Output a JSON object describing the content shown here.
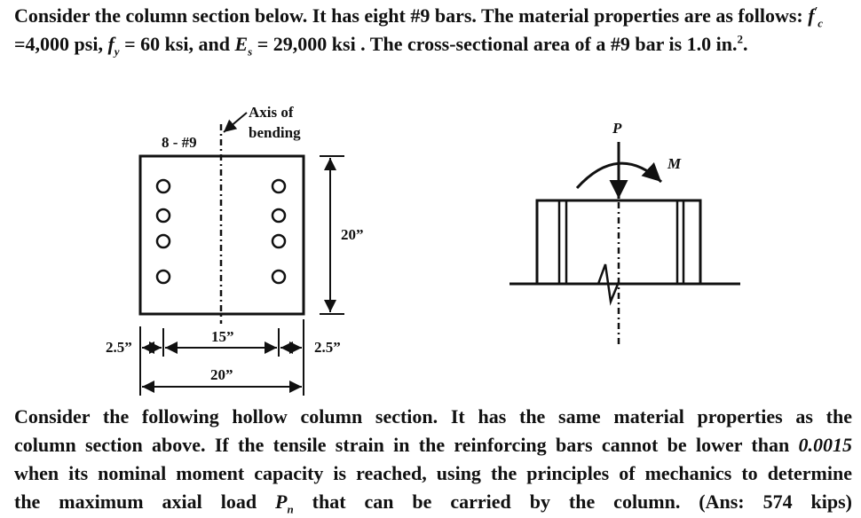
{
  "problem_intro": {
    "line1_text": "Consider the column section below. It has eight #9 bars. The material properties are as follows: ",
    "fc_symbol": "f",
    "fc_sub": "c",
    "fc_prime": "′",
    "line2_fc_value": "=4,000 psi, ",
    "fy_symbol": "f",
    "fy_sub": "y",
    "fy_value": " = 60 ksi, and ",
    "es_symbol": "E",
    "es_sub": "s",
    "es_value": " = 29,000 ksi . The cross-sectional area of a #9 bar is 1.0 in.",
    "area_sup": "2",
    "area_end": "."
  },
  "section_diagram": {
    "bars_label": "8 - #9",
    "axis_label_line1": "Axis of",
    "axis_label_line2": "bending",
    "height_dim": "20”",
    "left_cover_dim": "2.5”",
    "bar_spacing_dim": "15”",
    "right_cover_dim": "2.5”",
    "width_dim": "20”",
    "bar_count_per_side": 4
  },
  "elevation_diagram": {
    "load_label": "P",
    "moment_label": "M"
  },
  "problem_question": {
    "line1": "Consider the following hollow column section. It has the same material properties as the",
    "line2_a": "column section above. If the tensile strain in the reinforcing bars cannot be lower than ",
    "line2_strain": "0.0015",
    "line3": "when its nominal moment capacity is reached, using the principles of mechanics to determine",
    "line4_a": "the maximum axial load ",
    "pn_symbol": "P",
    "pn_sub": "n",
    "line4_b": " that can be carried by the column. (Ans: 574 kips)"
  }
}
